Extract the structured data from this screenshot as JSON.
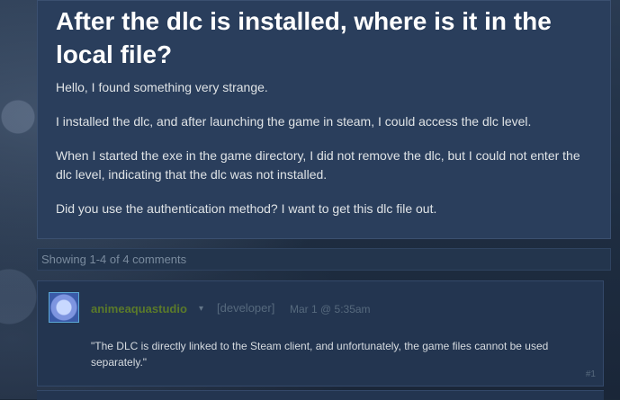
{
  "post": {
    "title": "After the dlc is installed, where is it in the local file?",
    "paragraphs": [
      "Hello, I found something very strange.",
      "I installed the dlc, and after launching the game in steam, I could access the dlc level.",
      "When I started the exe in the game directory, I did not remove the dlc, but I could not enter the dlc level, indicating that the dlc was not installed.",
      "Did you use the authentication method? I want to get this dlc file out."
    ]
  },
  "comments_header": {
    "showing": "Showing 1-4 of 4 comments"
  },
  "comments": [
    {
      "author": "animeaquastudio",
      "role": "[developer]",
      "date": "Mar 1 @ 5:35am",
      "text": "\"The DLC is directly linked to the Steam client, and unfortunately, the game files cannot be used separately.\"",
      "number": "#1"
    }
  ],
  "icons": {
    "author_menu": "chevron-down-icon",
    "avatar": "avatar-image"
  },
  "colors": {
    "developer_name": "#5b7a2a",
    "background": "#1b2838",
    "post_panel": "#2a3e5c"
  }
}
